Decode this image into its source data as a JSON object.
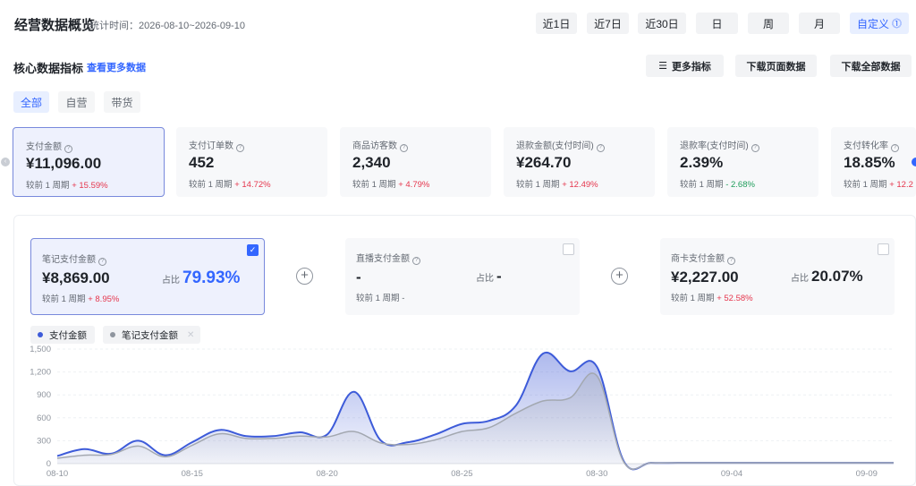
{
  "header": {
    "title": "经营数据概览",
    "range_label": "统计时间：2026-08-10~2026-09-10",
    "ranges": [
      "近1日",
      "近7日",
      "近30日",
      "日",
      "周",
      "月",
      "自定义"
    ],
    "custom_icon": "⓵"
  },
  "section": {
    "title": "核心数据指标",
    "more_link": "查看更多数据",
    "more_metrics": "更多指标",
    "download_page": "下载页面数据",
    "download_all": "下载全部数据"
  },
  "tabs": [
    "全部",
    "自营",
    "带货"
  ],
  "metrics": [
    {
      "label": "支付金额",
      "value": "¥11,096.00",
      "compare": "较前 1 周期",
      "delta": "+ 15.59%",
      "trend": "up"
    },
    {
      "label": "支付订单数",
      "value": "452",
      "compare": "较前 1 周期",
      "delta": "+ 14.72%",
      "trend": "up"
    },
    {
      "label": "商品访客数",
      "value": "2,340",
      "compare": "较前 1 周期",
      "delta": "+ 4.79%",
      "trend": "up"
    },
    {
      "label": "退款金额(支付时间)",
      "value": "¥264.70",
      "compare": "较前 1 周期",
      "delta": "+ 12.49%",
      "trend": "up"
    },
    {
      "label": "退款率(支付时间)",
      "value": "2.39%",
      "compare": "较前 1 周期",
      "delta": "- 2.68%",
      "trend": "down"
    },
    {
      "label": "支付转化率",
      "value": "18.85%",
      "compare": "较前 1 周期",
      "delta": "+ 12.2",
      "trend": "up"
    }
  ],
  "channels": [
    {
      "label": "笔记支付金额",
      "value": "¥8,869.00",
      "share_label": "占比",
      "share": "79.93%",
      "compare": "较前 1 周期",
      "delta": "+ 8.95%"
    },
    {
      "label": "直播支付金额",
      "value": "-",
      "share_label": "占比",
      "share": "-",
      "compare": "较前 1 周期",
      "delta": "-"
    },
    {
      "label": "商卡支付金额",
      "value": "¥2,227.00",
      "share_label": "占比",
      "share": "20.07%",
      "compare": "较前 1 周期",
      "delta": "+ 52.58%"
    }
  ],
  "legend": [
    {
      "name": "支付金额",
      "color": "#3d5bd9"
    },
    {
      "name": "笔记支付金额",
      "color": "#8f959e"
    }
  ],
  "chart_data": {
    "type": "area",
    "x": [
      "08-10",
      "08-11",
      "08-12",
      "08-13",
      "08-14",
      "08-15",
      "08-16",
      "08-17",
      "08-18",
      "08-19",
      "08-20",
      "08-21",
      "08-22",
      "08-23",
      "08-24",
      "08-25",
      "08-26",
      "08-27",
      "08-28",
      "08-29",
      "08-30",
      "08-31",
      "09-01",
      "09-02",
      "09-03",
      "09-04",
      "09-05",
      "09-06",
      "09-07",
      "09-08",
      "09-09",
      "09-10"
    ],
    "x_tick_labels": [
      "08-10",
      "08-15",
      "08-20",
      "08-25",
      "08-30",
      "09-04",
      "09-09"
    ],
    "y_ticks": [
      "0",
      "300",
      "600",
      "900",
      "1,200",
      "1,500"
    ],
    "ylim": [
      0,
      1500
    ],
    "series": [
      {
        "name": "支付金额",
        "color": "#3d5bd9",
        "values": [
          100,
          190,
          130,
          300,
          110,
          280,
          440,
          360,
          360,
          410,
          380,
          940,
          300,
          280,
          380,
          520,
          560,
          760,
          1440,
          1210,
          1270,
          30,
          10,
          10,
          10,
          10,
          10,
          10,
          10,
          10,
          10,
          10
        ]
      },
      {
        "name": "笔记支付金额",
        "color": "#a3a8b0",
        "values": [
          70,
          110,
          120,
          230,
          90,
          240,
          390,
          330,
          330,
          360,
          350,
          420,
          270,
          250,
          310,
          420,
          470,
          660,
          820,
          860,
          1150,
          20,
          10,
          10,
          10,
          10,
          10,
          10,
          10,
          10,
          10,
          10
        ]
      }
    ],
    "grid": true
  }
}
